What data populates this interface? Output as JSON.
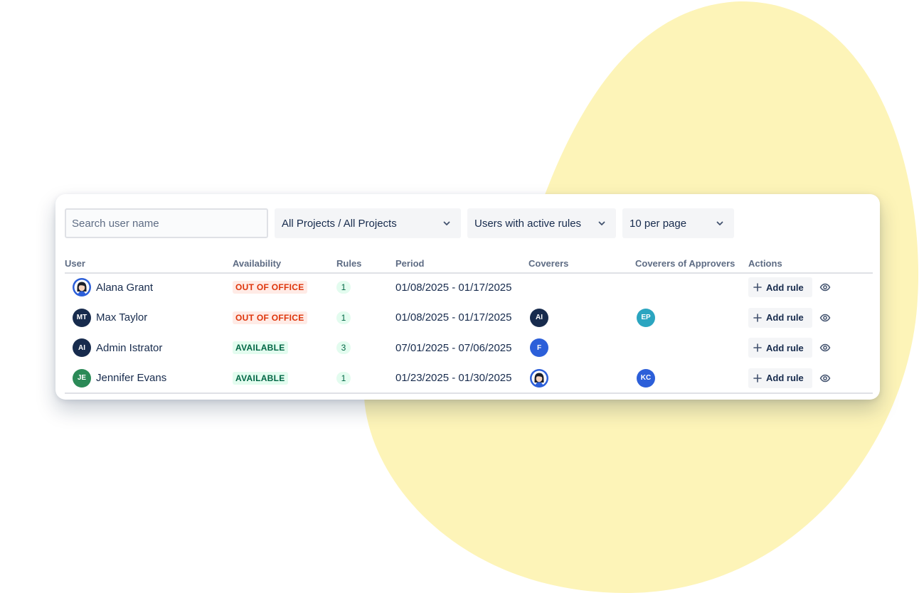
{
  "colors": {
    "blob": "#fdf4b8",
    "ooo_bg": "#ffebe6",
    "ooo_text": "#de350b",
    "avail_bg": "#e3fcef",
    "avail_text": "#006644",
    "avatar_navy": "#172b4d",
    "avatar_green": "#2b8a57",
    "avatar_blue": "#2c5fd9",
    "avatar_teal": "#2ba5c0"
  },
  "filters": {
    "search_placeholder": "Search user name",
    "project_select": "All Projects / All Projects",
    "rules_select": "Users with active rules",
    "page_select": "10 per page"
  },
  "columns": {
    "user": "User",
    "availability": "Availability",
    "rules": "Rules",
    "period": "Period",
    "coverers": "Coverers",
    "coverers_of_approvers": "Coverers of Approvers",
    "actions": "Actions"
  },
  "rows": [
    {
      "avatar": {
        "type": "photo",
        "icon": "woman-avatar-photo"
      },
      "name": "Alana Grant",
      "availability": "OUT OF OFFICE",
      "status": "ooo",
      "rules": "1",
      "period": "01/08/2025 - 01/17/2025",
      "coverer": null,
      "approver_coverer": null,
      "action": "Add rule"
    },
    {
      "avatar": {
        "type": "initials",
        "text": "MT",
        "color": "#172b4d"
      },
      "name": "Max Taylor",
      "availability": "OUT OF OFFICE",
      "status": "ooo",
      "rules": "1",
      "period": "01/08/2025 - 01/17/2025",
      "coverer": {
        "type": "initials",
        "text": "AI",
        "color": "#172b4d"
      },
      "approver_coverer": {
        "type": "initials",
        "text": "EP",
        "color": "#2ba5c0"
      },
      "action": "Add rule"
    },
    {
      "avatar": {
        "type": "initials",
        "text": "AI",
        "color": "#172b4d"
      },
      "name": "Admin Istrator",
      "availability": "AVAILABLE",
      "status": "avail",
      "rules": "3",
      "period": "07/01/2025 - 07/06/2025",
      "coverer": {
        "type": "initials",
        "text": "F",
        "color": "#2c5fd9"
      },
      "approver_coverer": null,
      "action": "Add rule"
    },
    {
      "avatar": {
        "type": "initials",
        "text": "JE",
        "color": "#2b8a57"
      },
      "name": "Jennifer Evans",
      "availability": "AVAILABLE",
      "status": "avail",
      "rules": "1",
      "period": "01/23/2025 - 01/30/2025",
      "coverer": {
        "type": "photo",
        "icon": "woman-avatar-photo"
      },
      "approver_coverer": {
        "type": "initials",
        "text": "KC",
        "color": "#2c5fd9"
      },
      "action": "Add rule"
    }
  ],
  "icons": {
    "select_chevron": "chevron-down-icon",
    "add": "plus-icon",
    "view": "eye-icon"
  }
}
